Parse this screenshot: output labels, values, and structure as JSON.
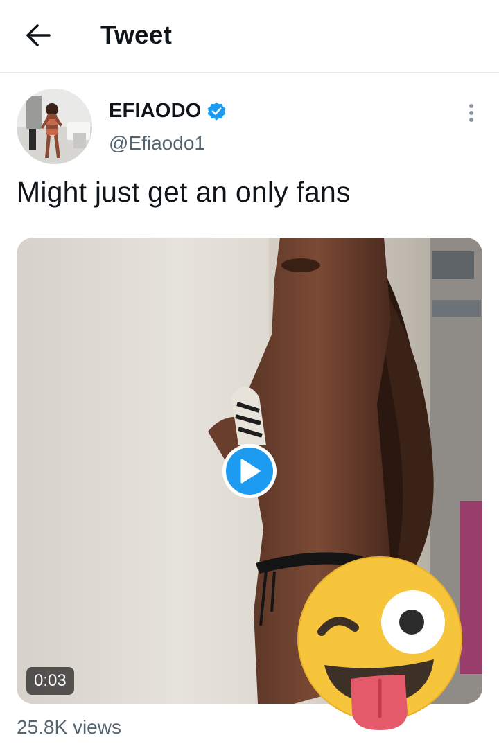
{
  "header": {
    "title": "Tweet",
    "back_icon": "arrow-left-icon"
  },
  "tweet": {
    "author_name": "EFIAODO",
    "author_handle": "@Efiaodo1",
    "verified": true,
    "text": "Might just get an only fans",
    "more_icon": "more-vertical-icon"
  },
  "media": {
    "type": "video",
    "duration": "0:03",
    "play_icon": "play-icon",
    "accent_color": "#1d9bf0"
  },
  "stats": {
    "views": "25.8K views"
  },
  "overlay": {
    "emoji": "winking-face-with-tongue-emoji"
  }
}
